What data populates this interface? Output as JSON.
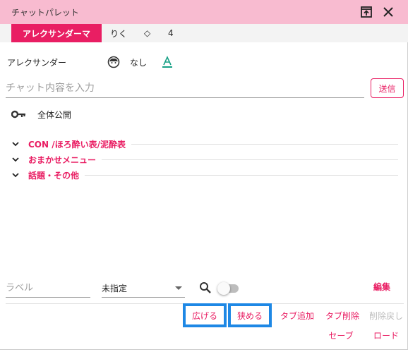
{
  "window": {
    "title": "チャットパレット",
    "popout_icon": "popout-icon",
    "close_icon": "close-icon"
  },
  "tabs": [
    {
      "label": "アレクサンダーマ",
      "active": true
    },
    {
      "label": "りく",
      "active": false
    },
    {
      "label": "◇",
      "active": false
    },
    {
      "label": "4",
      "active": false
    }
  ],
  "character": {
    "name": "アレクサンダー",
    "face_icon": "face-icon",
    "face_label": "なし",
    "font_icon": "text-color-icon",
    "font_color": "#16a085"
  },
  "chat": {
    "placeholder": "チャット内容を入力",
    "value": "",
    "send_label": "送信"
  },
  "scope": {
    "icon": "key-icon",
    "label": "全体公開"
  },
  "sections": [
    {
      "label": "CON /ほろ酔い表/泥酔表"
    },
    {
      "label": "おまかせメニュー"
    },
    {
      "label": "話題・その他"
    }
  ],
  "controls": {
    "label_placeholder": "ラベル",
    "select_value": "未指定",
    "search_icon": "search-icon",
    "toggle_on": false,
    "edit_label": "編集"
  },
  "actions": {
    "widen": "広げる",
    "narrow": "狭める",
    "tab_add": "タブ追加",
    "tab_delete": "タブ削除",
    "undo_delete": "削除戻し",
    "save": "セーブ",
    "load": "ロード"
  },
  "colors": {
    "accent": "#e91e63",
    "titlebar": "#f8bbd0",
    "highlight": "#1e88e5"
  }
}
